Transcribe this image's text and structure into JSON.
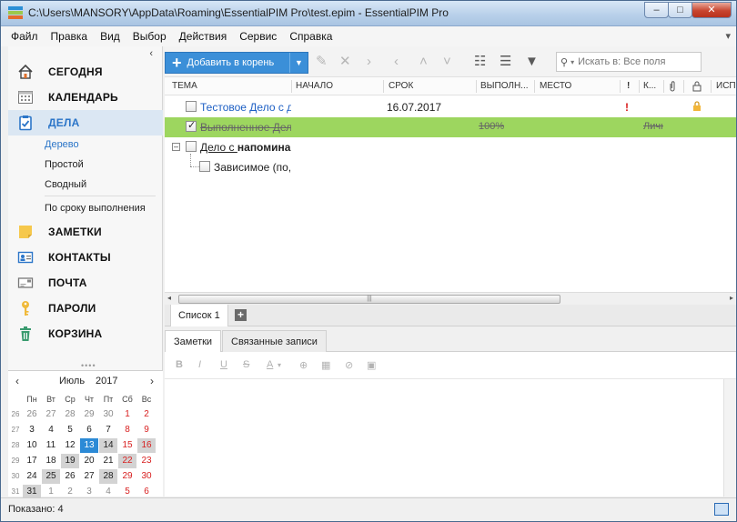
{
  "window": {
    "title": "C:\\Users\\MANSORY\\AppData\\Roaming\\EssentialPIM Pro\\test.epim - EssentialPIM Pro",
    "minimize": "–",
    "maximize": "□",
    "close": "✕"
  },
  "menu": [
    "Файл",
    "Правка",
    "Вид",
    "Выбор",
    "Действия",
    "Сервис",
    "Справка"
  ],
  "menu_right": "▾",
  "nav": {
    "collapse": "‹",
    "items": [
      {
        "label": "СЕГОДНЯ",
        "icon": "home-icon"
      },
      {
        "label": "КАЛЕНДАРЬ",
        "icon": "calendar-icon"
      },
      {
        "label": "ДЕЛА",
        "icon": "tasks-icon"
      },
      {
        "label": "ЗАМЕТКИ",
        "icon": "notes-icon"
      },
      {
        "label": "КОНТАКТЫ",
        "icon": "contacts-icon"
      },
      {
        "label": "ПОЧТА",
        "icon": "mail-icon"
      },
      {
        "label": "ПАРОЛИ",
        "icon": "key-icon"
      },
      {
        "label": "КОРЗИНА",
        "icon": "trash-icon"
      }
    ],
    "subviews": [
      "Дерево",
      "Простой",
      "Сводный",
      "По сроку выполнения"
    ]
  },
  "calendar": {
    "month": "Июль",
    "year": "2017",
    "prev": "‹",
    "next": "›",
    "weekday_headers": [
      "Пн",
      "Вт",
      "Ср",
      "Чт",
      "Пт",
      "Сб",
      "Вс"
    ],
    "weeks": [
      {
        "wk": "26",
        "days": [
          "26",
          "27",
          "28",
          "29",
          "30",
          "1",
          "2"
        ]
      },
      {
        "wk": "27",
        "days": [
          "3",
          "4",
          "5",
          "6",
          "7",
          "8",
          "9"
        ]
      },
      {
        "wk": "28",
        "days": [
          "10",
          "11",
          "12",
          "13",
          "14",
          "15",
          "16"
        ]
      },
      {
        "wk": "29",
        "days": [
          "17",
          "18",
          "19",
          "20",
          "21",
          "22",
          "23"
        ]
      },
      {
        "wk": "30",
        "days": [
          "24",
          "25",
          "26",
          "27",
          "28",
          "29",
          "30"
        ]
      },
      {
        "wk": "31",
        "days": [
          "31",
          "1",
          "2",
          "3",
          "4",
          "5",
          "6"
        ]
      }
    ]
  },
  "toolbar": {
    "add_label": "Добавить в корень",
    "search_placeholder": "Искать в: Все поля"
  },
  "grid": {
    "columns": [
      "ТЕМА",
      "НАЧАЛО",
      "СРОК",
      "ВЫПОЛН...",
      "МЕСТО",
      "!",
      "К...",
      "",
      "",
      "ИСП"
    ],
    "rows": [
      {
        "subject": "Тестовое Дело с д",
        "due": "16.07.2017",
        "priority": "!",
        "complete": "",
        "category": ""
      },
      {
        "subject": "Выполненное Дел",
        "due": "",
        "priority": "",
        "complete": "100%",
        "category": "Личн"
      },
      {
        "subject_prefix": "Дело с ",
        "subject_bold": "напомина",
        "due": "",
        "priority": "",
        "complete": "",
        "category": ""
      },
      {
        "subject": "Зависимое (по,",
        "due": "",
        "priority": "",
        "complete": "",
        "category": ""
      }
    ]
  },
  "list_tab": "Список 1",
  "add_tab": "+",
  "notes": {
    "tabs": [
      "Заметки",
      "Связанные записи"
    ],
    "format_buttons": [
      "B",
      "I",
      "U",
      "S",
      "A"
    ]
  },
  "status": "Показано: 4"
}
